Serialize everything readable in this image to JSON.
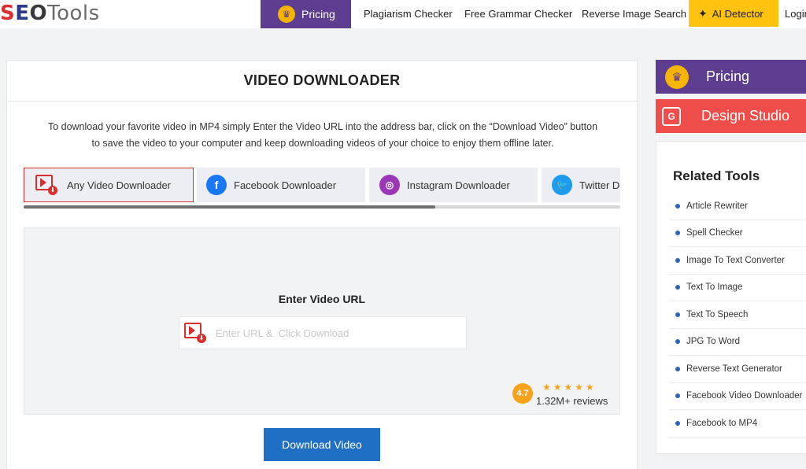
{
  "logo": {
    "s": "S",
    "e": "E",
    "o": "O",
    "t": "Tools"
  },
  "nav": {
    "pricing": "Pricing",
    "links": [
      "Plagiarism Checker",
      "Free Grammar Checker",
      "Reverse Image Search"
    ],
    "ai_detector": "AI Detector",
    "login": "Login"
  },
  "main": {
    "title": "VIDEO DOWNLOADER",
    "intro": "To download your favorite video in MP4 simply Enter the Video URL into the address bar, click on the “Download Video” button to save the video to your computer and keep downloading videos of your choice to enjoy them offline later.",
    "tabs": [
      {
        "label": "Any Video Downloader",
        "icon": "video-download-icon",
        "active": true
      },
      {
        "label": "Facebook Downloader",
        "icon": "facebook-icon",
        "color": "#1877f2"
      },
      {
        "label": "Instagram Downloader",
        "icon": "instagram-icon",
        "color": "#9b36b7"
      },
      {
        "label": "Twitter Downloader",
        "icon": "twitter-icon",
        "color": "#1d9bf0"
      }
    ],
    "scroll_position": 0.69,
    "enter_label": "Enter Video URL",
    "url_placeholder": "Enter URL &  Click Download",
    "rating": {
      "score": "4.7",
      "stars": 5,
      "reviews": "1.32M+ reviews"
    },
    "download_button": "Download Video"
  },
  "sidebar": {
    "pricing": "Pricing",
    "design_studio": "Design Studio",
    "related_title": "Related Tools",
    "related_tools": [
      "Article Rewriter",
      "Spell Checker",
      "Image To Text Converter",
      "Text To Image",
      "Text To Speech",
      "JPG To Word",
      "Reverse Text Generator",
      "Facebook Video Downloader",
      "Facebook to MP4"
    ]
  },
  "colors": {
    "purple": "#5d3d8f",
    "yellow": "#ffc20e",
    "red": "#ef4d4a",
    "blue": "#1f6fc5",
    "star": "#f7a21b"
  }
}
